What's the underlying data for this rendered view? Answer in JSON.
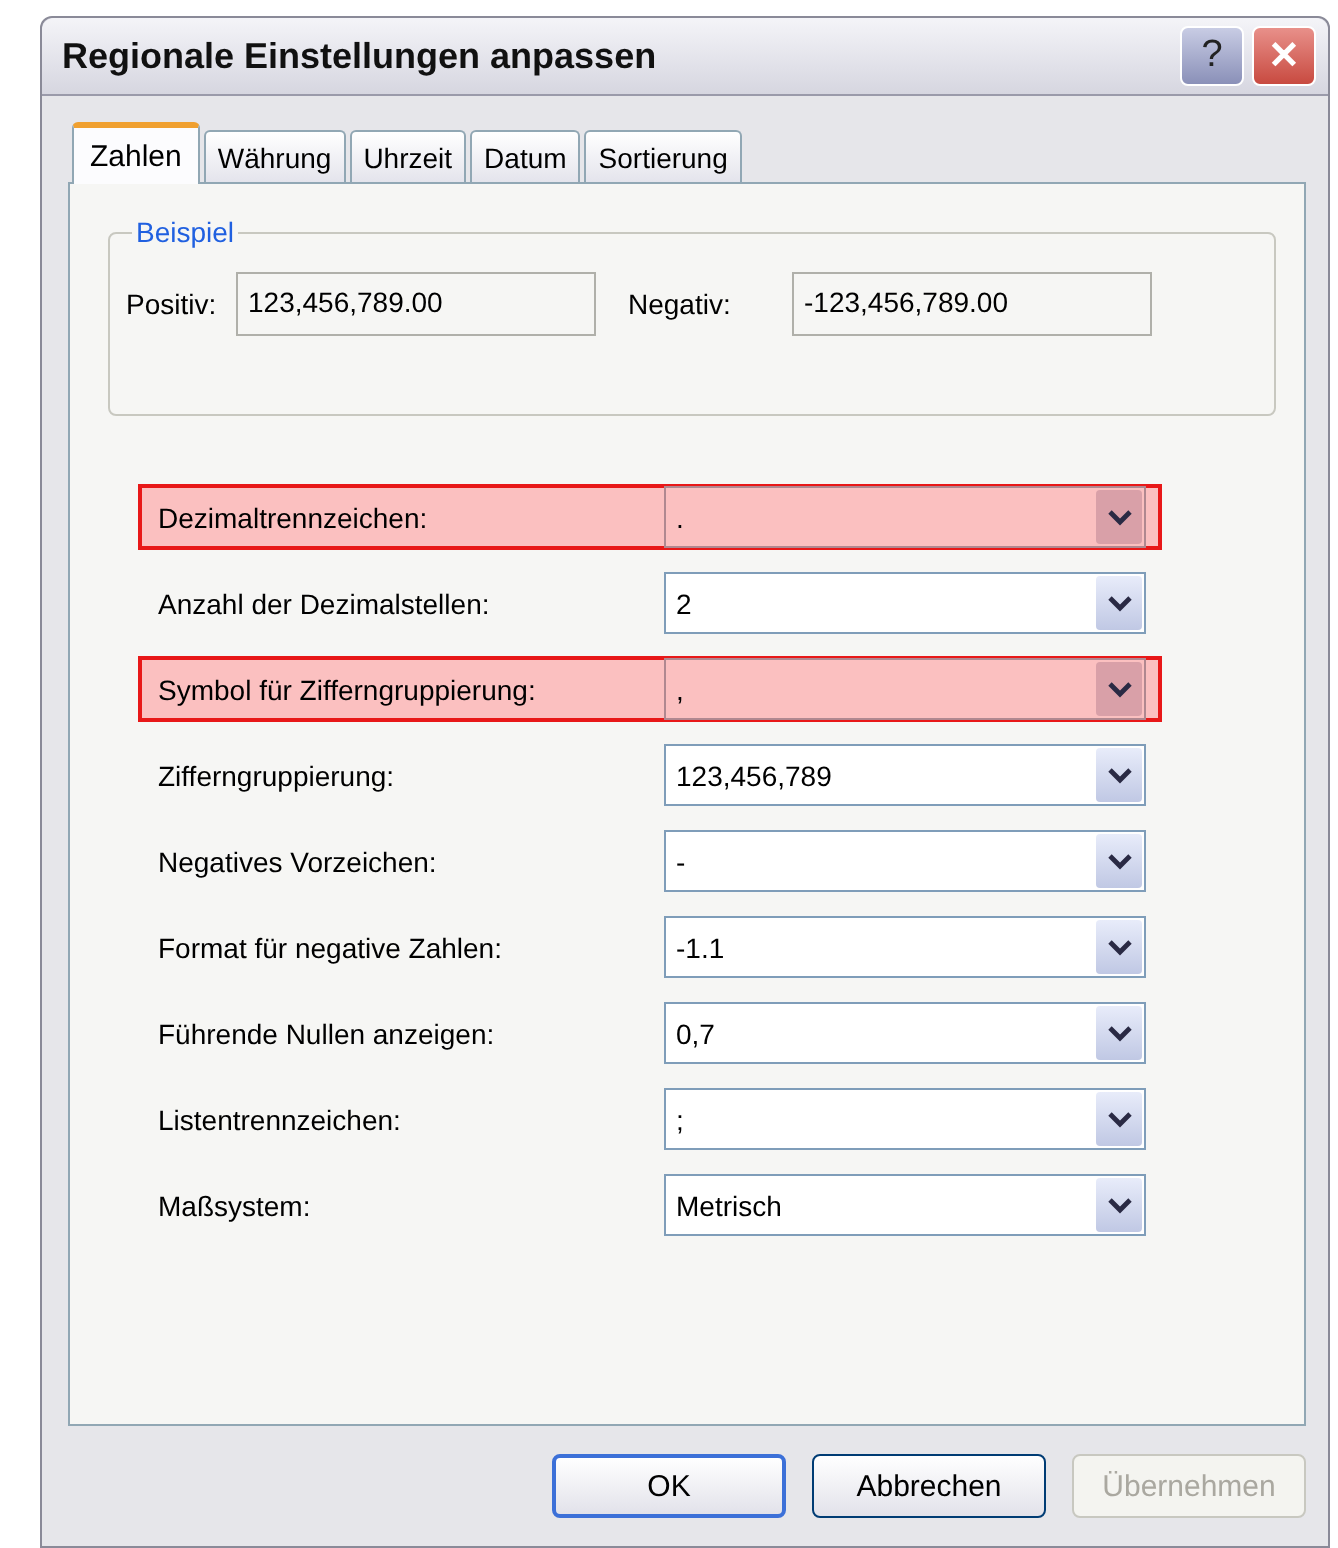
{
  "window": {
    "title": "Regionale Einstellungen anpassen",
    "help_button": "?",
    "close_button": "✕"
  },
  "tabs": [
    {
      "label": "Zahlen",
      "selected": true
    },
    {
      "label": "Währung",
      "selected": false
    },
    {
      "label": "Uhrzeit",
      "selected": false
    },
    {
      "label": "Datum",
      "selected": false
    },
    {
      "label": "Sortierung",
      "selected": false
    }
  ],
  "example": {
    "legend": "Beispiel",
    "positive_label": "Positiv:",
    "positive_value": "123,456,789.00",
    "negative_label": "Negativ:",
    "negative_value": "-123,456,789.00"
  },
  "settings": [
    {
      "label": "Dezimaltrennzeichen:",
      "value": ".",
      "highlighted": true
    },
    {
      "label": "Anzahl der Dezimalstellen:",
      "value": "2",
      "highlighted": false
    },
    {
      "label": "Symbol für Zifferngruppierung:",
      "value": ",",
      "highlighted": true
    },
    {
      "label": "Zifferngruppierung:",
      "value": "123,456,789",
      "highlighted": false
    },
    {
      "label": "Negatives Vorzeichen:",
      "value": "-",
      "highlighted": false
    },
    {
      "label": "Format für negative Zahlen:",
      "value": "-1.1",
      "highlighted": false
    },
    {
      "label": "Führende Nullen anzeigen:",
      "value": "0,7",
      "highlighted": false
    },
    {
      "label": "Listentrennzeichen:",
      "value": ";",
      "highlighted": false
    },
    {
      "label": "Maßsystem:",
      "value": "Metrisch",
      "highlighted": false
    }
  ],
  "buttons": [
    {
      "label": "OK",
      "default": true,
      "disabled": false
    },
    {
      "label": "Abbrechen",
      "default": false,
      "disabled": false
    },
    {
      "label": "Übernehmen",
      "default": false,
      "disabled": true
    }
  ]
}
